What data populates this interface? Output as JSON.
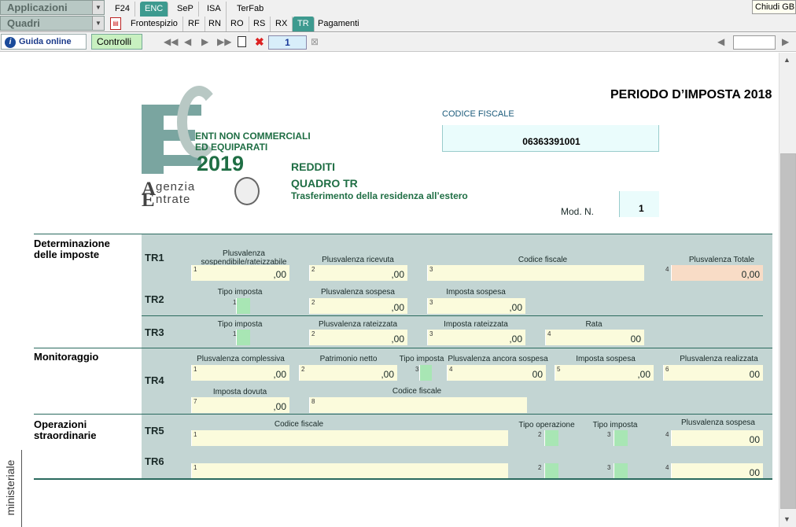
{
  "topbar": {
    "applicazioni": "Applicazioni",
    "quadri": "Quadri",
    "tabs_row1": [
      "F24",
      "ENC",
      "SeP",
      "ISA",
      "TerFab"
    ],
    "tabs_row2": [
      "Frontespizio",
      "RF",
      "RN",
      "RO",
      "RS",
      "RX",
      "TR",
      "Pagamenti"
    ],
    "chiudi": "Chiudi GB"
  },
  "toolbar": {
    "guida": "Guida online",
    "controlli": "Controlli",
    "page_num": "1"
  },
  "header": {
    "periodo": "PERIODO D’IMPOSTA 2018",
    "codice_fiscale_label": "CODICE FISCALE",
    "codice_fiscale": "06363391001",
    "enti_line1": "ENTI NON COMMERCIALI",
    "enti_line2": "ED EQUIPARATI",
    "year": "2019",
    "agenzia": "genzia",
    "entrate": "ntrate",
    "redditi": "REDDITI",
    "quadro": "QUADRO TR",
    "trasferimento": "Trasferimento della residenza all’estero",
    "mod_label": "Mod. N.",
    "mod_value": "1"
  },
  "sections": {
    "determinazione": "Determinazione delle imposte",
    "monitoraggio": "Monitoraggio",
    "operazioni": "Operazioni straordinarie"
  },
  "rows": {
    "tr1": {
      "id": "TR1",
      "l1": "Plusvalenza sospendibile/rateizzabile",
      "l2": "Plusvalenza ricevuta",
      "l3": "Codice fiscale",
      "l4": "Plusvalenza Totale",
      "v1": ",00",
      "v2": ",00",
      "v4": "0,00"
    },
    "tr2": {
      "id": "TR2",
      "l1": "Tipo imposta",
      "l2": "Plusvalenza sospesa",
      "l3": "Imposta sospesa",
      "v2": ",00",
      "v3": ",00"
    },
    "tr3": {
      "id": "TR3",
      "l1": "Tipo imposta",
      "l2": "Plusvalenza rateizzata",
      "l3": "Imposta rateizzata",
      "l4": "Rata",
      "v2": ",00",
      "v3": ",00",
      "v4": "00"
    },
    "tr4": {
      "id": "TR4",
      "l1": "Plusvalenza complessiva",
      "l2": "Patrimonio netto",
      "l3": "Tipo imposta",
      "l4": "Plusvalenza ancora sospesa",
      "l5": "Imposta sospesa",
      "l6": "Plusvalenza realizzata",
      "l7": "Imposta dovuta",
      "l8": "Codice fiscale",
      "v1": ",00",
      "v2": ",00",
      "v4": "00",
      "v5": ",00",
      "v6": "00",
      "v7": ",00"
    },
    "tr5": {
      "id": "TR5",
      "l1": "Codice fiscale",
      "l2": "Tipo operazione",
      "l3": "Tipo imposta",
      "l4": "Plusvalenza sospesa",
      "v4": "00"
    },
    "tr6": {
      "id": "TR6",
      "v4": "00"
    }
  },
  "sidebar_text": "ministeriale",
  "colors": {
    "teal": "#3d9a8f",
    "row_bg": "#c3d5d3",
    "field": "#fbfbdc",
    "green_field": "#a8e6b4",
    "title_green": "#1f6e44"
  }
}
